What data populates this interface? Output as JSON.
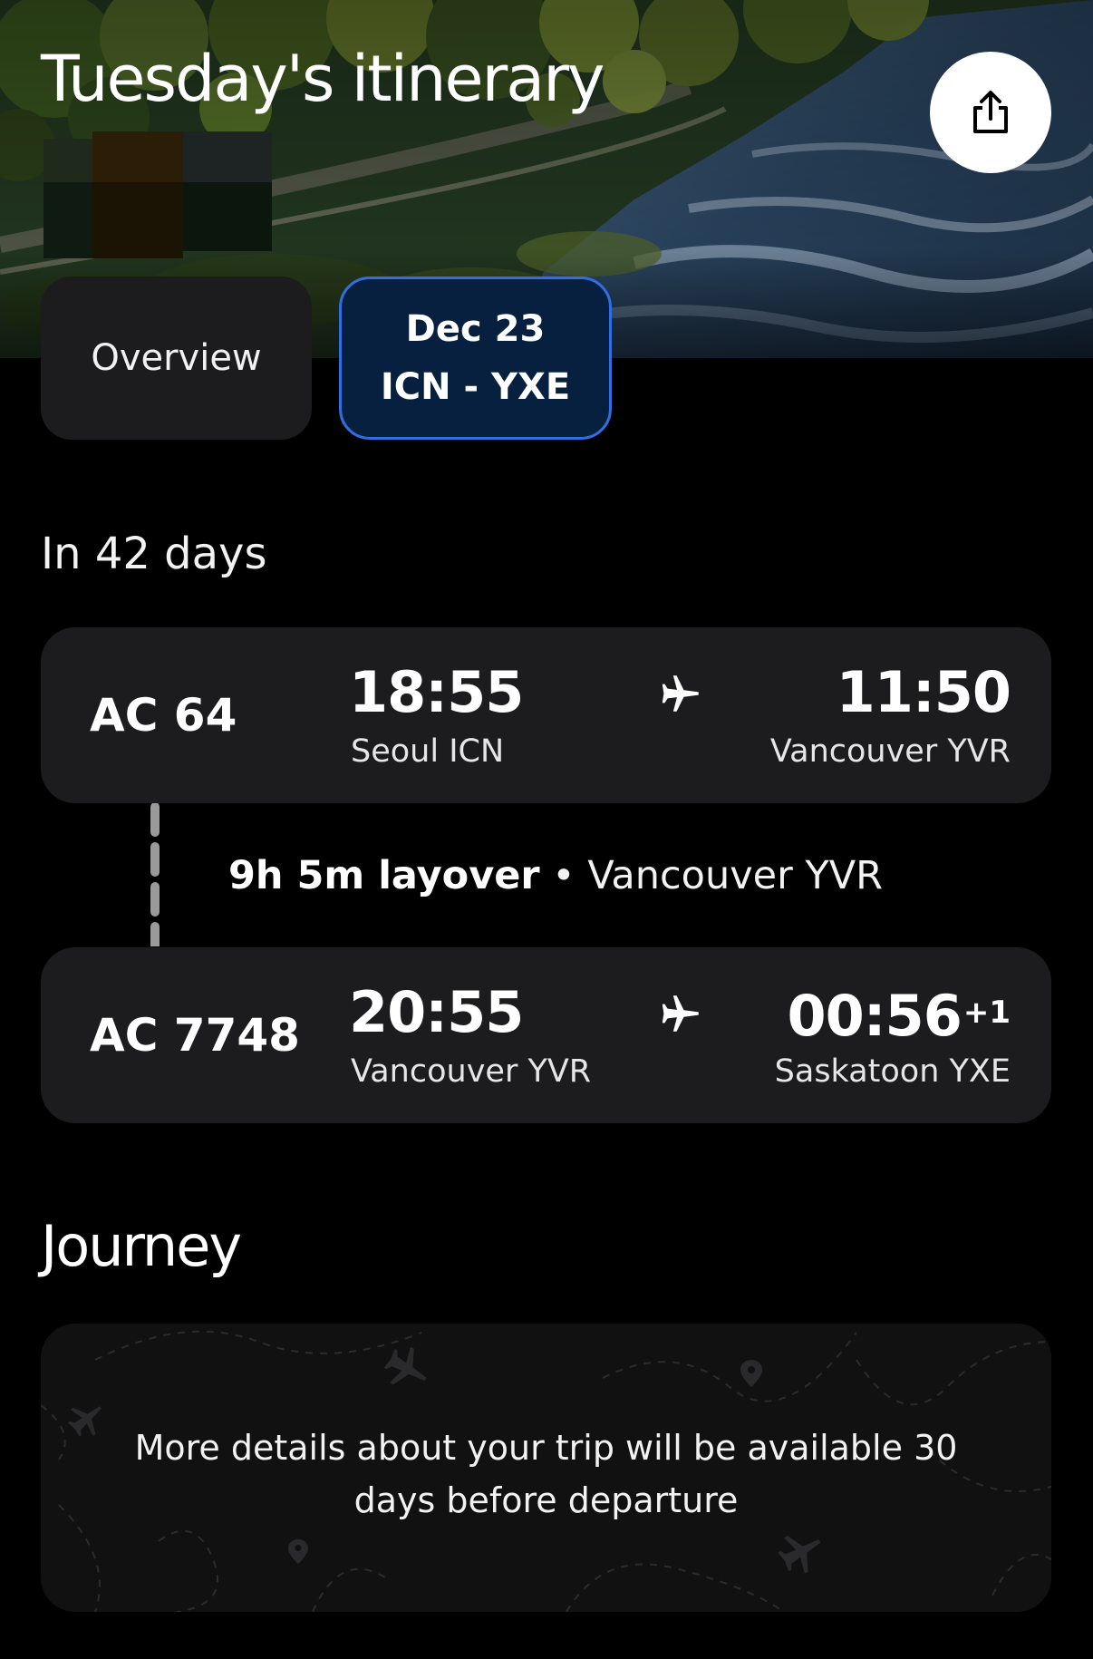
{
  "header": {
    "title": "Tuesday's itinerary",
    "share_icon": "share-icon"
  },
  "tabs": [
    {
      "label": "Overview",
      "selected": false
    },
    {
      "date": "Dec 23",
      "route": "ICN - YXE",
      "selected": true
    }
  ],
  "countdown": "In 42 days",
  "flights": [
    {
      "number": "AC 64",
      "departure_time": "18:55",
      "departure_city": "Seoul ICN",
      "arrival_time": "11:50",
      "arrival_day_offset": "",
      "arrival_city": "Vancouver YVR"
    },
    {
      "number": "AC 7748",
      "departure_time": "20:55",
      "departure_city": "Vancouver YVR",
      "arrival_time": "00:56",
      "arrival_day_offset": "+1",
      "arrival_city": "Saskatoon YXE"
    }
  ],
  "layover": {
    "duration": "9h 5m layover",
    "separator": " • ",
    "location": "Vancouver YVR"
  },
  "journey": {
    "title": "Journey",
    "message": "More details about your trip will be available 30 days before departure"
  },
  "colors": {
    "background": "#000000",
    "card": "#1c1b1d",
    "selected_tab_bg": "#07203f",
    "selected_tab_border": "#2f6fe0"
  }
}
